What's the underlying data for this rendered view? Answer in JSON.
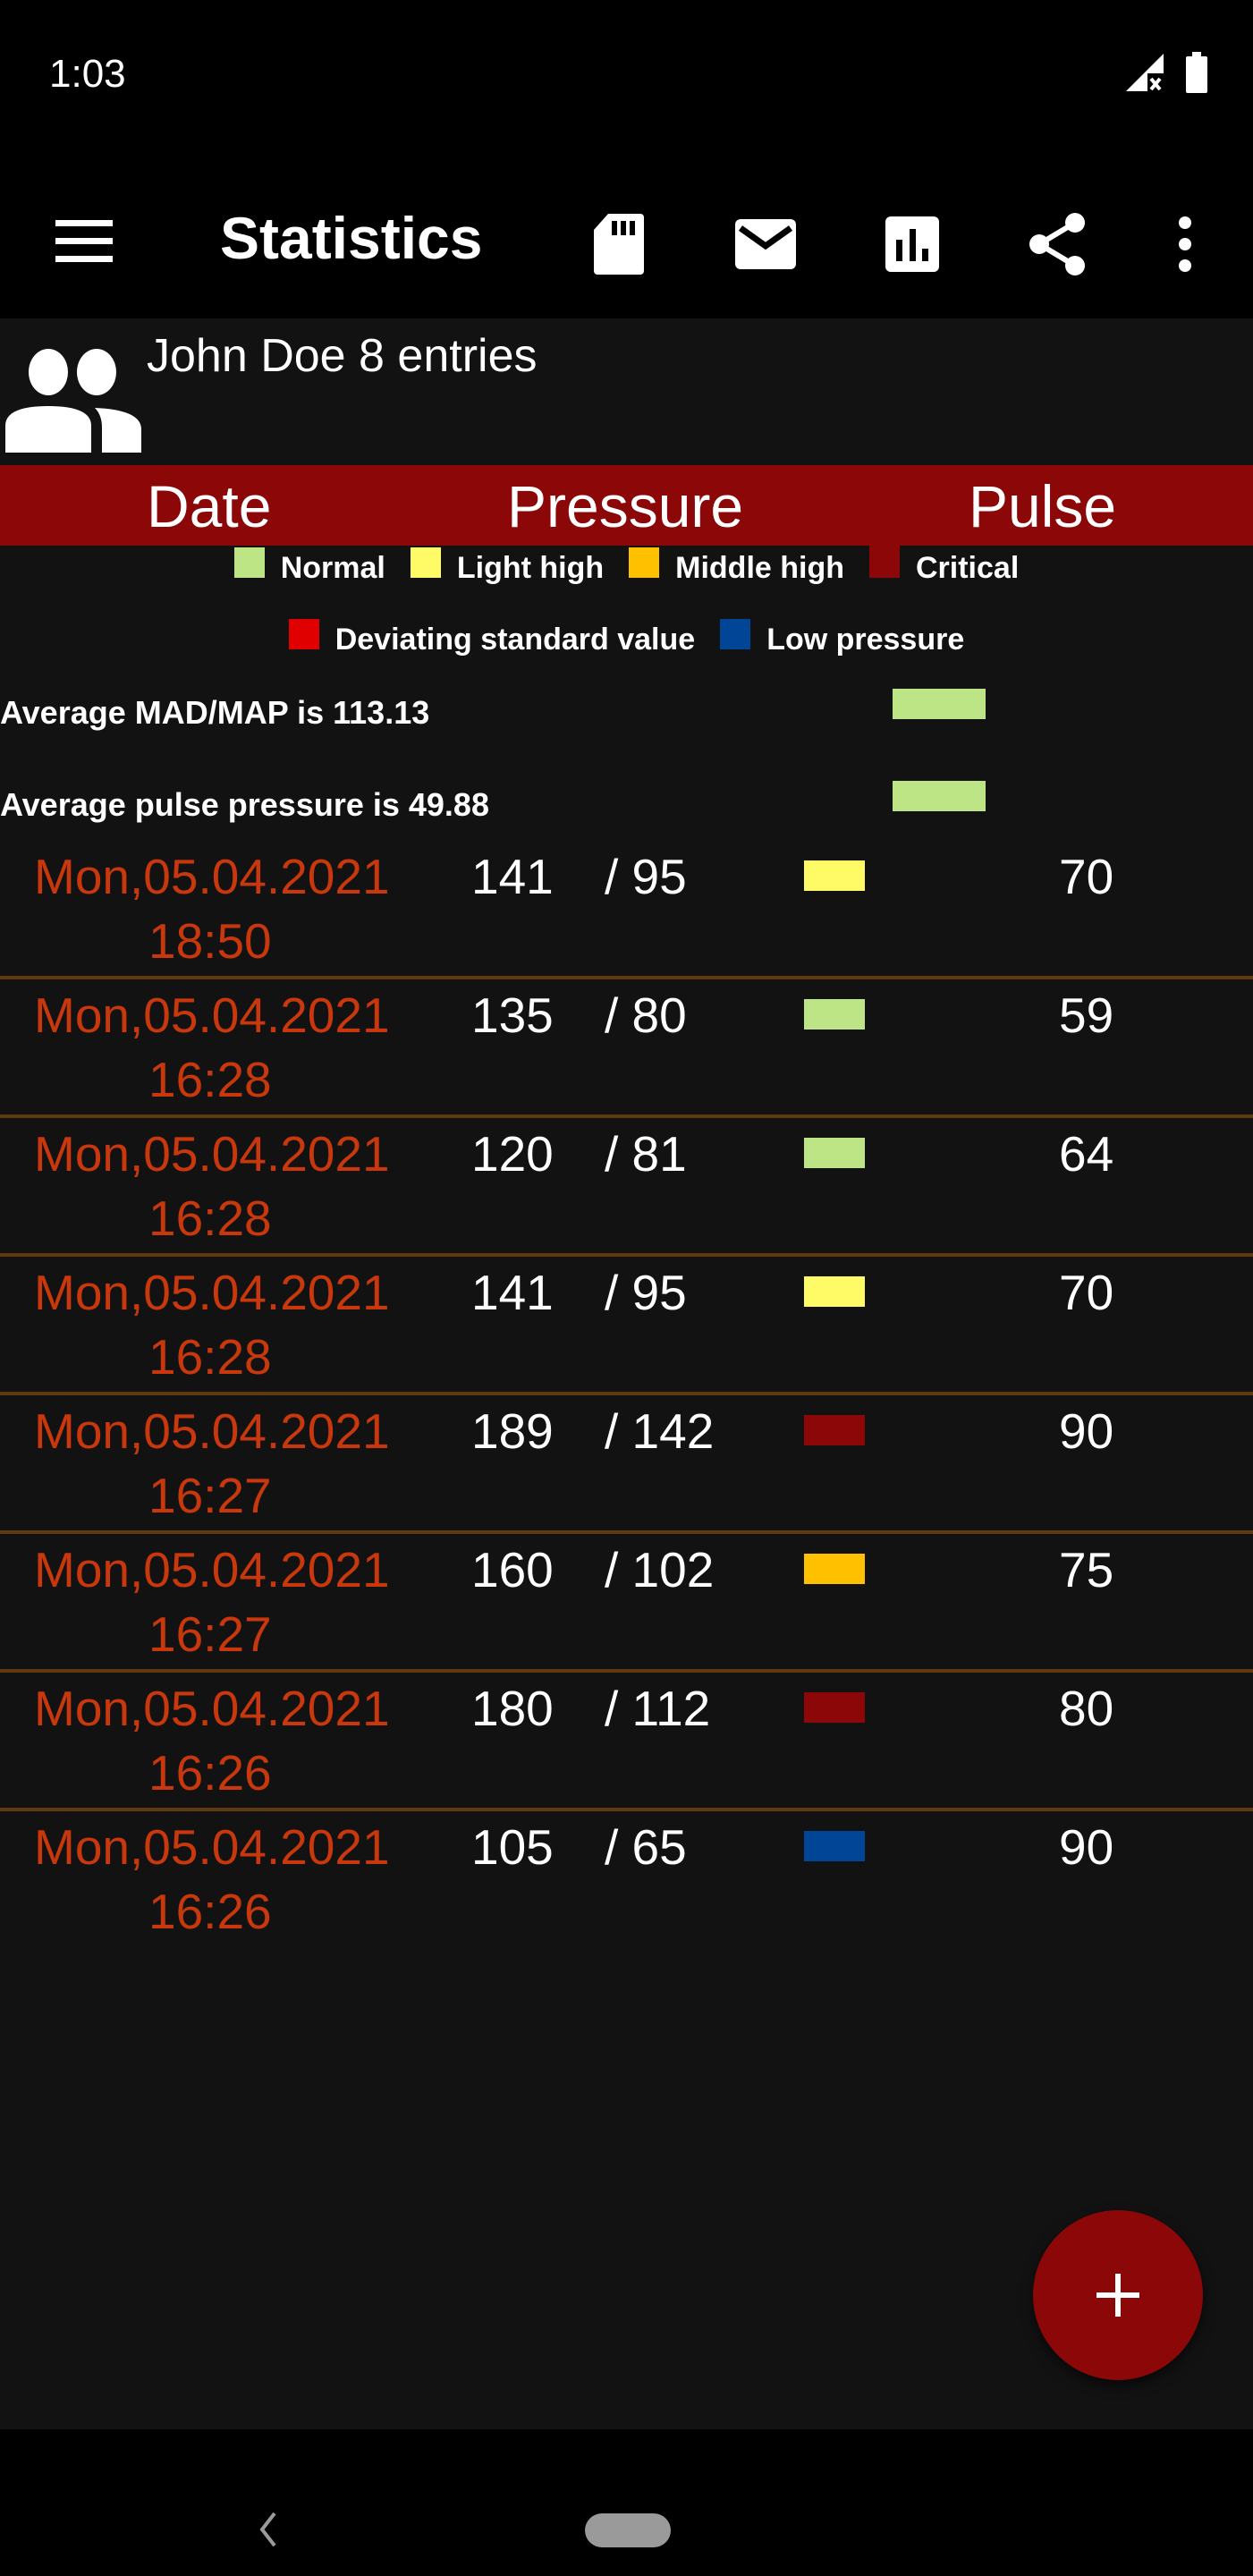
{
  "status_bar": {
    "time": "1:03",
    "icons": [
      "signal-no-service-icon",
      "battery-icon"
    ]
  },
  "app_bar": {
    "title": "Statistics",
    "actions": [
      "sd-card-icon",
      "email-icon",
      "chart-icon",
      "share-icon",
      "more-vert-icon"
    ]
  },
  "user": {
    "label": "John Doe 8 entries"
  },
  "table_header": {
    "date": "Date",
    "pressure": "Pressure",
    "pulse": "Pulse"
  },
  "legend": [
    {
      "label": "Normal",
      "color": "#bde585"
    },
    {
      "label": "Light high",
      "color": "#fffb66"
    },
    {
      "label": "Middle high",
      "color": "#ffc000"
    },
    {
      "label": "Critical",
      "color": "#8b0708"
    },
    {
      "label": "Deviating standard value",
      "color": "#e00000"
    },
    {
      "label": "Low pressure",
      "color": "#014696"
    }
  ],
  "averages": {
    "map_text": "Average MAD/MAP is 113.13",
    "map_color": "#bde585",
    "pulse_pressure_text": "Average pulse pressure is 49.88",
    "pulse_pressure_color": "#bde585"
  },
  "entries": [
    {
      "date": "Mon,05.04.2021",
      "time": "18:50",
      "systolic": "141",
      "diastolic": "/ 95",
      "pulse": "70",
      "category": "Light high",
      "color": "#fffb66"
    },
    {
      "date": "Mon,05.04.2021",
      "time": "16:28",
      "systolic": "135",
      "diastolic": "/ 80",
      "pulse": "59",
      "category": "Normal",
      "color": "#bde585"
    },
    {
      "date": "Mon,05.04.2021",
      "time": "16:28",
      "systolic": "120",
      "diastolic": "/ 81",
      "pulse": "64",
      "category": "Normal",
      "color": "#bde585"
    },
    {
      "date": "Mon,05.04.2021",
      "time": "16:28",
      "systolic": "141",
      "diastolic": "/ 95",
      "pulse": "70",
      "category": "Light high",
      "color": "#fffb66"
    },
    {
      "date": "Mon,05.04.2021",
      "time": "16:27",
      "systolic": "189",
      "diastolic": "/ 142",
      "pulse": "90",
      "category": "Critical",
      "color": "#8b0708"
    },
    {
      "date": "Mon,05.04.2021",
      "time": "16:27",
      "systolic": "160",
      "diastolic": "/ 102",
      "pulse": "75",
      "category": "Middle high",
      "color": "#ffc000"
    },
    {
      "date": "Mon,05.04.2021",
      "time": "16:26",
      "systolic": "180",
      "diastolic": "/ 112",
      "pulse": "80",
      "category": "Critical",
      "color": "#8b0708"
    },
    {
      "date": "Mon,05.04.2021",
      "time": "16:26",
      "systolic": "105",
      "diastolic": "/ 65",
      "pulse": "90",
      "category": "Low pressure",
      "color": "#014696"
    }
  ],
  "fab": {
    "icon": "plus-icon",
    "label": "+"
  },
  "nav_bar": {
    "buttons": [
      "back-icon",
      "home-pill"
    ]
  }
}
